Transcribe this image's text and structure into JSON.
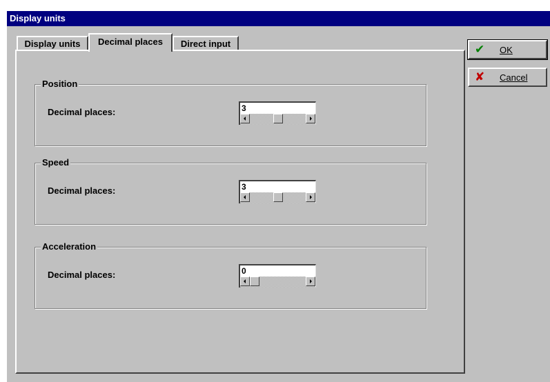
{
  "window": {
    "title": "Display units"
  },
  "tabs": [
    "Display units",
    "Decimal places",
    "Direct input"
  ],
  "groups": [
    {
      "title": "Position",
      "label": "Decimal places:",
      "value": "3",
      "slider_fraction": 0.5
    },
    {
      "title": "Speed",
      "label": "Decimal places:",
      "value": "3",
      "slider_fraction": 0.5
    },
    {
      "title": "Acceleration",
      "label": "Decimal places:",
      "value": "0",
      "slider_fraction": 0
    }
  ],
  "buttons": {
    "ok": {
      "label": "OK",
      "icon": "check-icon",
      "color": "#008000"
    },
    "cancel": {
      "label": "Cancel",
      "icon": "x-icon",
      "color": "#c00000"
    }
  },
  "colors": {
    "titlebar": "#000080",
    "face": "#c0c0c0"
  }
}
